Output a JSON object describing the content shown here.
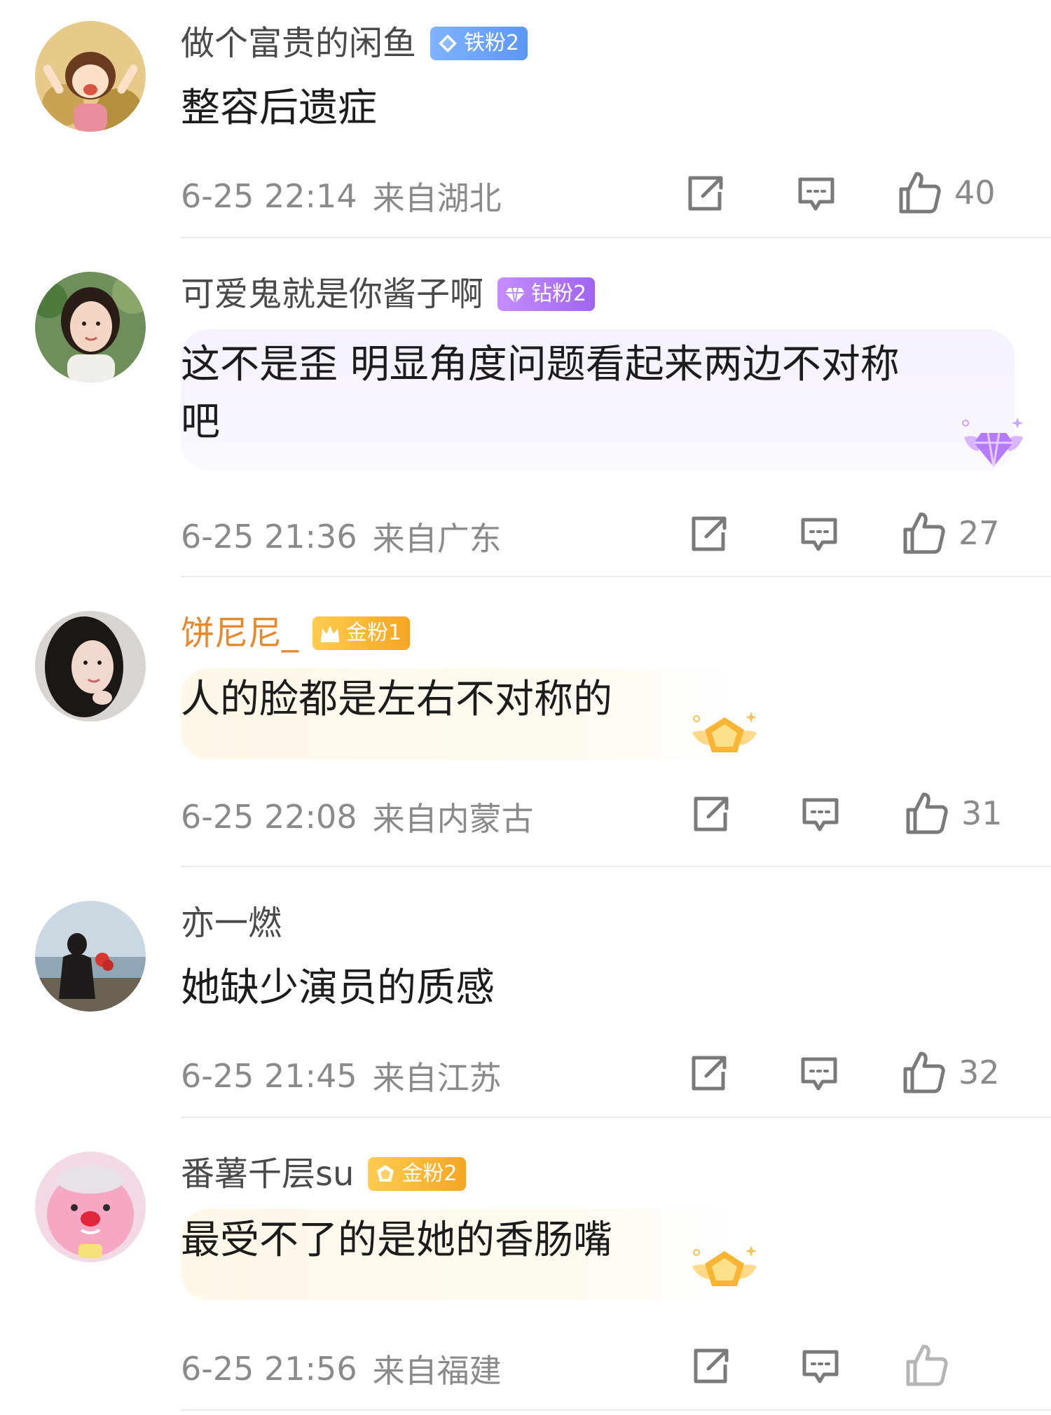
{
  "comments": [
    {
      "username": "做个富贵的闲鱼",
      "badge": "铁粉2",
      "content": [
        "整容后遗症"
      ],
      "timestamp": "6-25 22:14",
      "location": "来自湖北",
      "likes": "40"
    },
    {
      "username": "可爱鬼就是你酱子啊",
      "badge": "钻粉2",
      "content": [
        "这不是歪 明显角度问题看起来两边不对称",
        "吧"
      ],
      "timestamp": "6-25 21:36",
      "location": "来自广东",
      "likes": "27"
    },
    {
      "username": "饼尼尼_",
      "badge": "金粉1",
      "content": [
        "人的脸都是左右不对称的"
      ],
      "timestamp": "6-25 22:08",
      "location": "来自内蒙古",
      "likes": "31"
    },
    {
      "username": "亦一燃",
      "badge": "",
      "content": [
        "她缺少演员的质感"
      ],
      "timestamp": "6-25 21:45",
      "location": "来自江苏",
      "likes": "32"
    },
    {
      "username": "番薯千层su",
      "badge": "金粉2",
      "content": [
        "最受不了的是她的香肠嘴"
      ],
      "timestamp": "6-25 21:56",
      "location": "来自福建",
      "likes": ""
    }
  ],
  "icons": {
    "share": "share-icon",
    "comment": "comment-icon",
    "like": "thumbs-up-icon",
    "badge_iron": "diamond-badge-icon",
    "badge_diamond": "diamond-badge-icon",
    "badge_gold": "crown-badge-icon"
  },
  "colors": {
    "meta_gray": "#8a8a8a",
    "gold_username": "#e7892a",
    "iron_badge": "#6aa3f8",
    "diamond_badge": "#b07af6",
    "gold_badge": "#f7b533"
  }
}
